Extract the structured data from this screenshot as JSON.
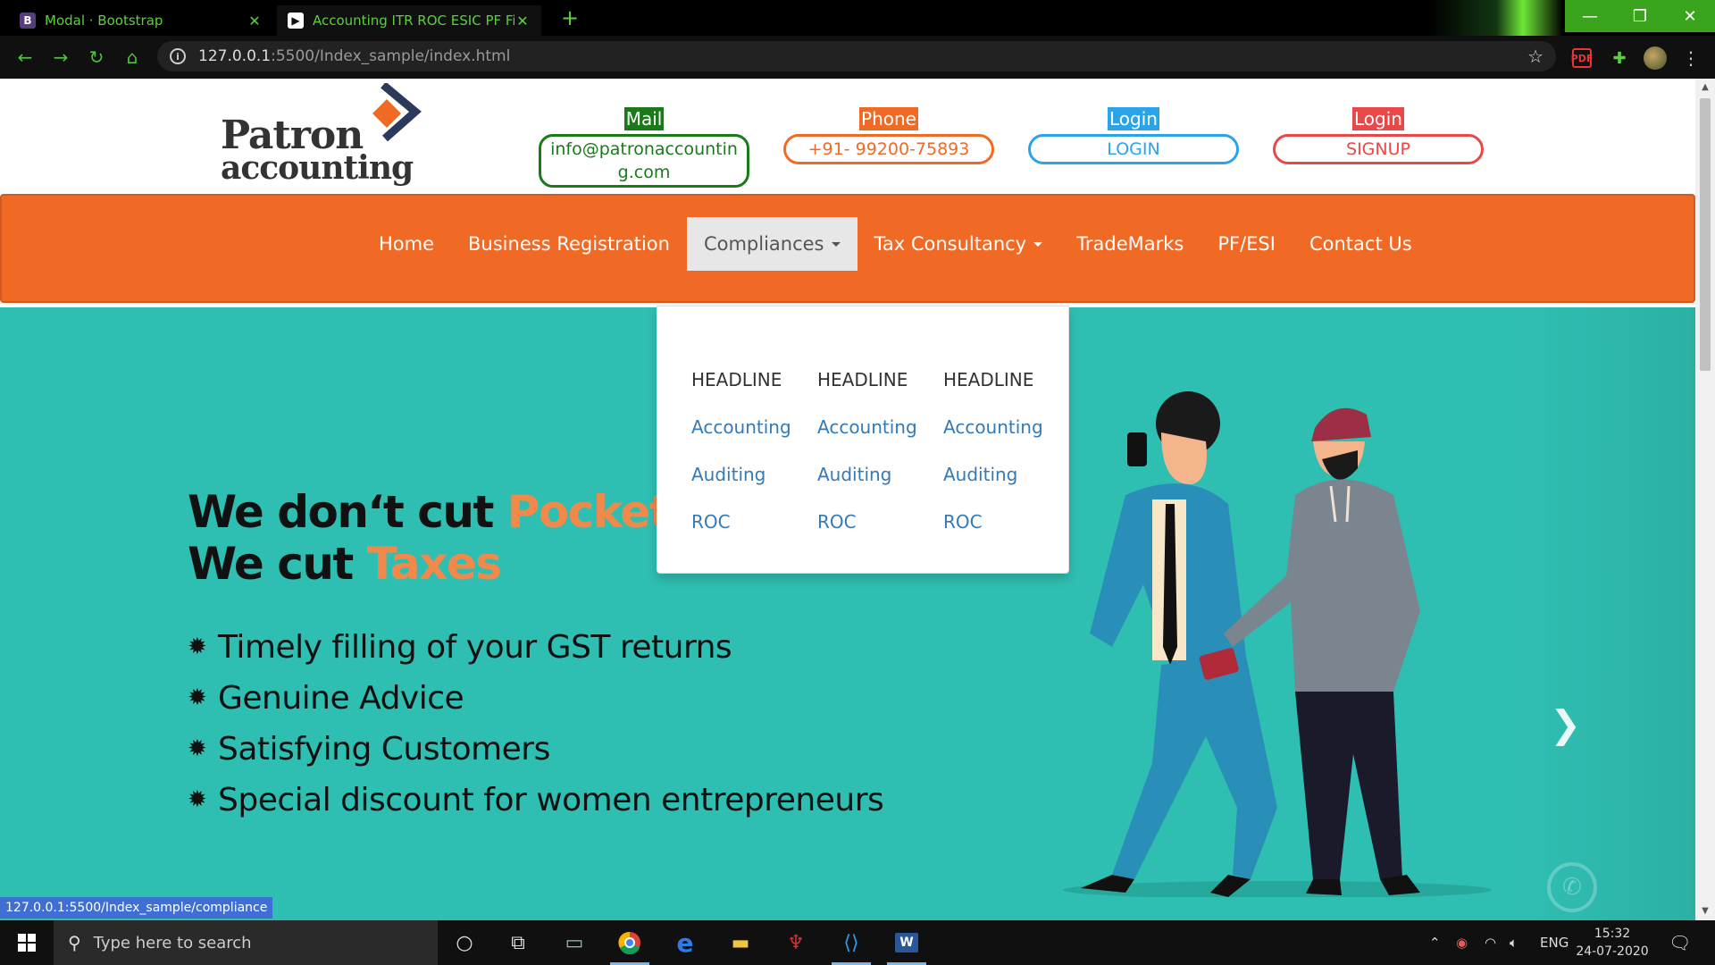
{
  "browser": {
    "tabs": [
      {
        "label": "Modal · Bootstrap",
        "favicon": "bootstrap-icon"
      },
      {
        "label": "Accounting ITR ROC ESIC PF Firm",
        "favicon": "patron-icon"
      }
    ],
    "url_host": "127.0.0.1",
    "url_rest": ":5500/Index_sample/index.html",
    "accent": "#5bd03c"
  },
  "header": {
    "logo_line1": "Patron",
    "logo_line2": "accounting",
    "mail": {
      "label": "Mail",
      "value": "info@patronaccounting.com"
    },
    "phone": {
      "label": "Phone",
      "value": "+91- 99200-75893"
    },
    "login": {
      "label": "Login",
      "value": "LOGIN"
    },
    "signup": {
      "label": "Login",
      "value": "SIGNUP"
    }
  },
  "nav": {
    "color": "#f06a25",
    "items": [
      "Home",
      "Business Registration",
      "Compliances",
      "Tax Consultancy",
      "TradeMarks",
      "PF/ESI",
      "Contact Us"
    ]
  },
  "dropdown": {
    "columns": [
      {
        "headline": "HEADLINE",
        "items": [
          "Accounting",
          "Auditing",
          "ROC"
        ]
      },
      {
        "headline": "HEADLINE",
        "items": [
          "Accounting",
          "Auditing",
          "ROC"
        ]
      },
      {
        "headline": "HEADLINE",
        "items": [
          "Accounting",
          "Auditing",
          "ROC"
        ]
      }
    ]
  },
  "hero": {
    "background": "#2fbfb2",
    "line1_a": "We don‘t cut ",
    "line1_b": "Pockets",
    "line2_a": "We cut ",
    "line2_b": "Taxes",
    "bullets": [
      "Timely filling of your GST returns",
      "Genuine Advice",
      "Satisfying Customers",
      "Special discount for women entrepreneurs"
    ]
  },
  "status_url": "127.0.0.1:5500/Index_sample/compliance",
  "taskbar": {
    "search_placeholder": "Type here to search",
    "lang": "ENG",
    "time": "15:32",
    "date": "24-07-2020"
  }
}
